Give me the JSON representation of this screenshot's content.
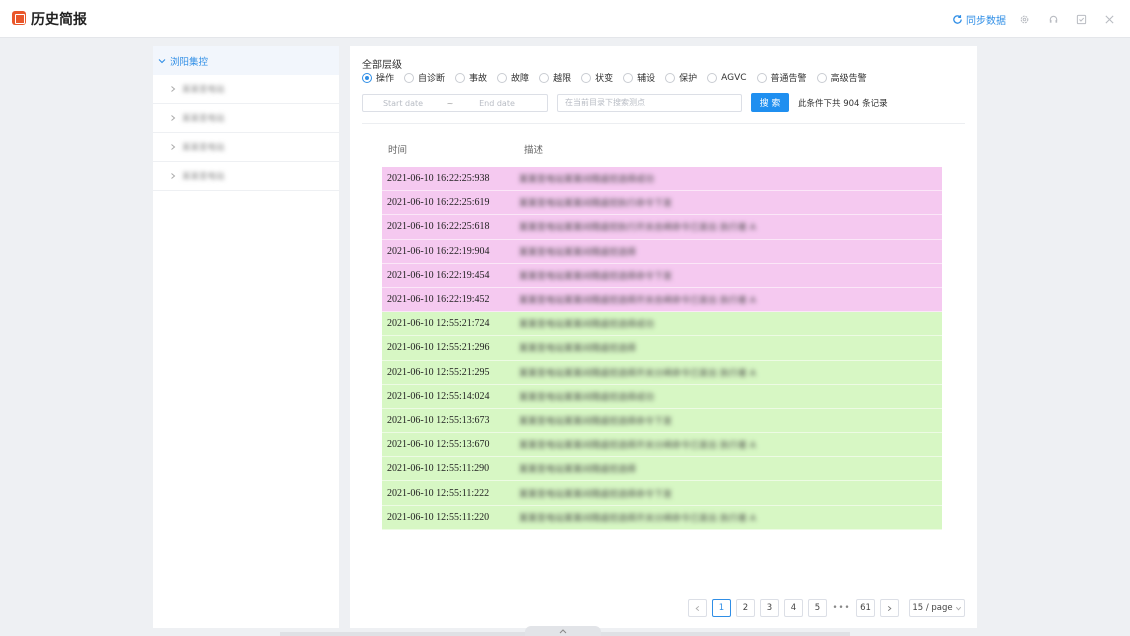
{
  "window": {
    "title": "历史简报",
    "sync_label": "同步数据",
    "accent": "#2f8ee6",
    "logo_color": "#e9572b"
  },
  "sidebar": {
    "root_label": "浏阳集控",
    "items": [
      {
        "label": "某某变电站"
      },
      {
        "label": "某某变电站"
      },
      {
        "label": "某某变电站"
      },
      {
        "label": "某某变电站"
      }
    ]
  },
  "filters": {
    "level_label": "全部层级",
    "levels": [
      "操作",
      "自诊断",
      "事故",
      "故障",
      "越限",
      "状变",
      "辅设",
      "保护",
      "AGVC",
      "普通告警",
      "高级告警"
    ],
    "selected_level": "操作",
    "start_placeholder": "Start date",
    "range_separator": "~",
    "end_placeholder": "End date",
    "search_placeholder": "在当前目录下搜索测点",
    "search_button": "搜 索",
    "result_count_text": "此条件下共 904 条记录"
  },
  "table": {
    "columns": [
      "时间",
      "描述"
    ],
    "rows": [
      {
        "time": "2021-06-10 16:22:25:938",
        "desc": "某某变电站某某间隔遥控选择成功",
        "status": "pink"
      },
      {
        "time": "2021-06-10 16:22:25:619",
        "desc": "某某变电站某某间隔遥控执行命令下发",
        "status": "pink"
      },
      {
        "time": "2021-06-10 16:22:25:618",
        "desc": "某某变电站某某间隔遥控执行开关合闸命令已发出 执行者 A",
        "status": "pink"
      },
      {
        "time": "2021-06-10 16:22:19:904",
        "desc": "某某变电站某某间隔遥控选择",
        "status": "pink"
      },
      {
        "time": "2021-06-10 16:22:19:454",
        "desc": "某某变电站某某间隔遥控选择命令下发",
        "status": "pink"
      },
      {
        "time": "2021-06-10 16:22:19:452",
        "desc": "某某变电站某某间隔遥控选择开关合闸命令已发出 执行者 A",
        "status": "pink"
      },
      {
        "time": "2021-06-10 12:55:21:724",
        "desc": "某某变电站某某间隔遥控选择成功",
        "status": "green"
      },
      {
        "time": "2021-06-10 12:55:21:296",
        "desc": "某某变电站某某间隔遥控选择",
        "status": "green"
      },
      {
        "time": "2021-06-10 12:55:21:295",
        "desc": "某某变电站某某间隔遥控选择开关分闸命令已发出 执行者 A",
        "status": "green"
      },
      {
        "time": "2021-06-10 12:55:14:024",
        "desc": "某某变电站某某间隔遥控选择成功",
        "status": "green"
      },
      {
        "time": "2021-06-10 12:55:13:673",
        "desc": "某某变电站某某间隔遥控选择命令下发",
        "status": "green"
      },
      {
        "time": "2021-06-10 12:55:13:670",
        "desc": "某某变电站某某间隔遥控选择开关分闸命令已发出 执行者 A",
        "status": "green"
      },
      {
        "time": "2021-06-10 12:55:11:290",
        "desc": "某某变电站某某间隔遥控选择",
        "status": "green"
      },
      {
        "time": "2021-06-10 12:55:11:222",
        "desc": "某某变电站某某间隔遥控选择命令下发",
        "status": "green"
      },
      {
        "time": "2021-06-10 12:55:11:220",
        "desc": "某某变电站某某间隔遥控选择开关分闸命令已发出 执行者 A",
        "status": "green"
      }
    ]
  },
  "pagination": {
    "pages": [
      "1",
      "2",
      "3",
      "4",
      "5"
    ],
    "current": "1",
    "ellipsis": "•••",
    "last_page": "61",
    "page_size": "15 / page"
  }
}
